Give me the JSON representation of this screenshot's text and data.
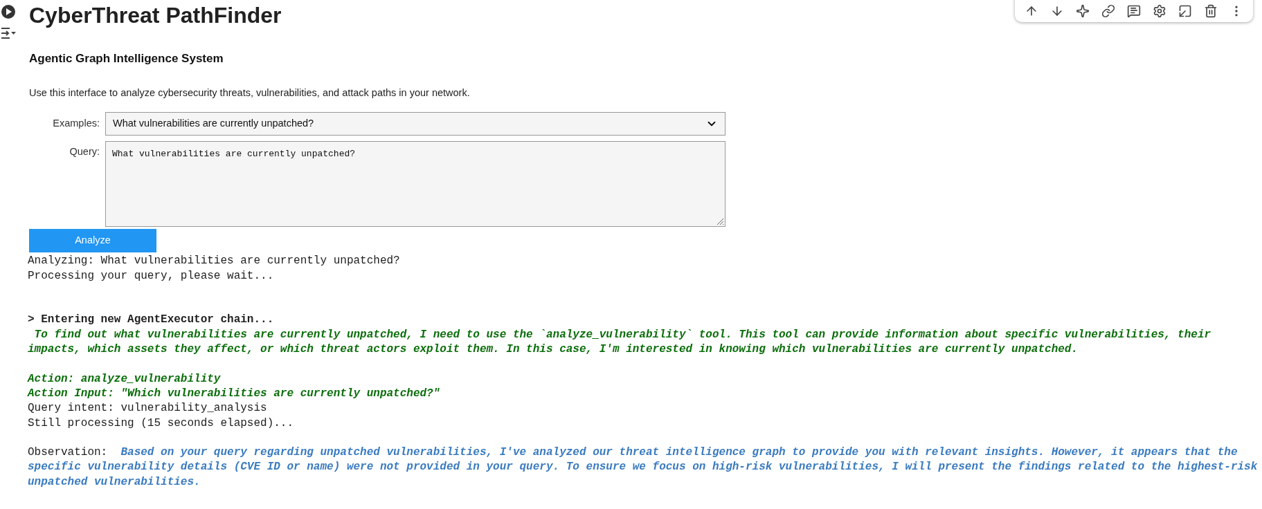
{
  "title": "CyberThreat PathFinder",
  "subtitle": "Agentic Graph Intelligence System",
  "description": "Use this interface to analyze cybersecurity threats, vulnerabilities, and attack paths in your network.",
  "examples": {
    "label": "Examples:",
    "value": "What vulnerabilities are currently unpatched?"
  },
  "query": {
    "label": "Query:",
    "value": "What vulnerabilities are currently unpatched?"
  },
  "analyze_button": "Analyze",
  "output": [
    {
      "kind": "line",
      "segments": [
        {
          "kind": "plain",
          "text": "Analyzing: What vulnerabilities are currently unpatched?"
        }
      ]
    },
    {
      "kind": "line",
      "segments": [
        {
          "kind": "plain",
          "text": "Processing your query, please wait..."
        }
      ]
    },
    {
      "kind": "blank"
    },
    {
      "kind": "blank"
    },
    {
      "kind": "line",
      "segments": [
        {
          "kind": "bold",
          "text": "> Entering new AgentExecutor chain..."
        }
      ]
    },
    {
      "kind": "line",
      "segments": [
        {
          "kind": "green",
          "text": " To find out what vulnerabilities are currently unpatched, I need to use the `analyze_vulnerability` tool. This tool can provide information about specific vulnerabilities, their"
        }
      ]
    },
    {
      "kind": "line",
      "segments": [
        {
          "kind": "green",
          "text": "impacts, which assets they affect, or which threat actors exploit them. In this case, I'm interested in knowing which vulnerabilities are currently unpatched."
        }
      ]
    },
    {
      "kind": "blank"
    },
    {
      "kind": "line",
      "segments": [
        {
          "kind": "green",
          "text": "Action: analyze_vulnerability"
        }
      ]
    },
    {
      "kind": "line",
      "segments": [
        {
          "kind": "green",
          "text": "Action Input: \"Which vulnerabilities are currently unpatched?\""
        }
      ]
    },
    {
      "kind": "line",
      "segments": [
        {
          "kind": "plain",
          "text": "Query intent: vulnerability_analysis"
        }
      ]
    },
    {
      "kind": "line",
      "segments": [
        {
          "kind": "plain",
          "text": "Still processing (15 seconds elapsed)..."
        }
      ]
    },
    {
      "kind": "blank"
    },
    {
      "kind": "line",
      "segments": [
        {
          "kind": "plain",
          "text": "Observation:  "
        },
        {
          "kind": "blue",
          "text": "Based on your query regarding unpatched vulnerabilities, I've analyzed our threat intelligence graph to provide you with relevant insights. However, it appears that the"
        }
      ]
    },
    {
      "kind": "line",
      "segments": [
        {
          "kind": "blue",
          "text": "specific vulnerability details (CVE ID or name) were not provided in your query. To ensure we focus on high-risk vulnerabilities, I will present the findings related to the highest-risk"
        }
      ]
    },
    {
      "kind": "line",
      "segments": [
        {
          "kind": "blue",
          "text": "unpatched vulnerabilities."
        }
      ]
    }
  ]
}
